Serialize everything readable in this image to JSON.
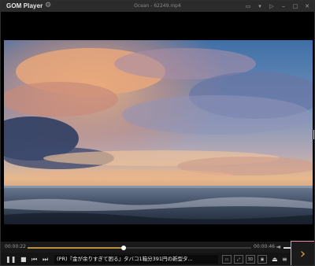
{
  "app": {
    "logo": "GOM Player",
    "title": "Ocean - 62249.mp4"
  },
  "window_controls": {
    "pin": "▭",
    "menu": "▾",
    "play_next": "▷",
    "minimize": "‒",
    "maximize": "□",
    "close": "✕"
  },
  "seekbar": {
    "current_time": "00:00:22",
    "total_time": "00:00:46",
    "progress_fraction": 0.43,
    "volume_fraction": 0.6
  },
  "ad_banner": {
    "text": "(PR)『金が余りすぎて困る』タバコ1箱分391円の新型タ..."
  },
  "controls": {
    "play_pause": "❚❚",
    "stop": "■",
    "prev": "⏮",
    "next": "⏭",
    "btn1": "▭",
    "btn2": "⤢",
    "btn3": "3D",
    "btn4": "▣",
    "eject": "⏏",
    "playlist": "≡",
    "expand": "›"
  },
  "colors": {
    "accent": "#b8923c",
    "highlight_border": "#e48fb0"
  }
}
